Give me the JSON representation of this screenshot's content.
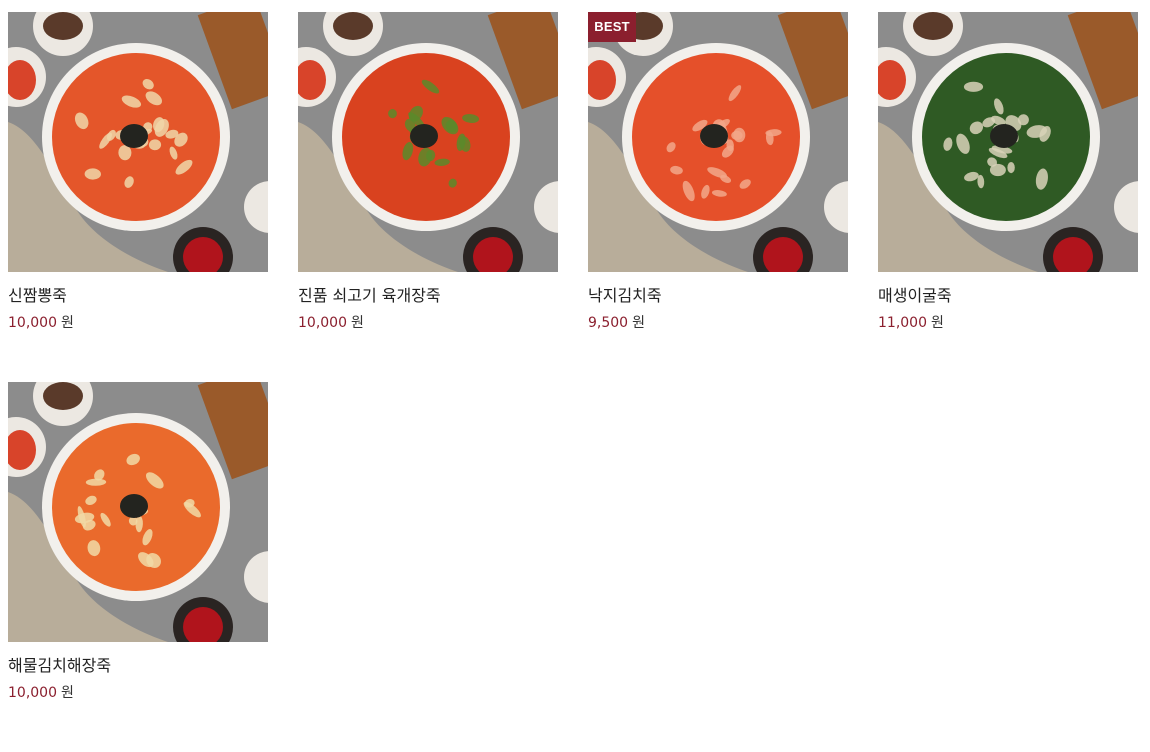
{
  "products": [
    {
      "name": "신짬뽕죽",
      "price": "10,000",
      "currency": "원",
      "badge": "",
      "porridge_color": "#e4562a",
      "topping_color": "#f0d6a8",
      "topping_icon": "seafood-icon"
    },
    {
      "name": "진품 쇠고기 육개장죽",
      "price": "10,000",
      "currency": "원",
      "badge": "",
      "porridge_color": "#d9421f",
      "topping_color": "#5a8a2a",
      "topping_icon": "beef-vegetable-icon"
    },
    {
      "name": "낙지김치죽",
      "price": "9,500",
      "currency": "원",
      "badge": "BEST",
      "porridge_color": "#e5502a",
      "topping_color": "#f2a789",
      "topping_icon": "octopus-icon"
    },
    {
      "name": "매생이굴죽",
      "price": "11,000",
      "currency": "원",
      "badge": "",
      "porridge_color": "#2f5a24",
      "topping_color": "#d8d2b8",
      "topping_icon": "oyster-icon"
    },
    {
      "name": "해물김치해장죽",
      "price": "10,000",
      "currency": "원",
      "badge": "",
      "porridge_color": "#ea6a2c",
      "topping_color": "#f1d9a6",
      "topping_icon": "seafood-icon"
    }
  ],
  "colors": {
    "accent": "#8b1f2e",
    "background_stone": "#8c8c8c",
    "bowl_rim": "#f2f0ec",
    "cloth": "#b8ad9a"
  }
}
